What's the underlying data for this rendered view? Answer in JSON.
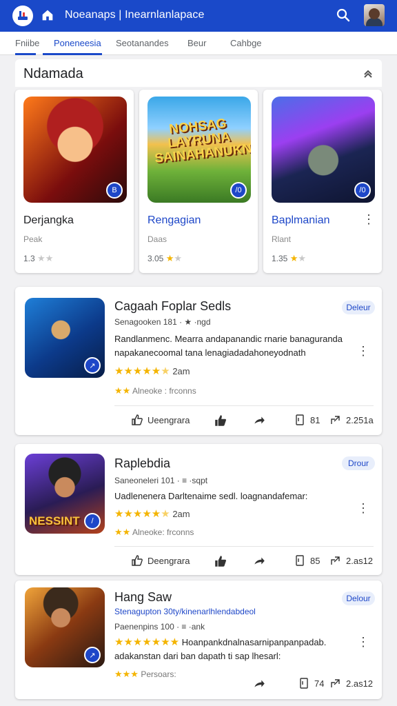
{
  "header": {
    "title": "Noeanaps | Inearnlanlapace",
    "logo_icon": "gamepad-logo-icon",
    "home_icon": "home-icon",
    "search_icon": "search-icon"
  },
  "tabs": [
    {
      "label": "Fniibe"
    },
    {
      "label": "Poneneesia"
    },
    {
      "label": "Seotanandes"
    },
    {
      "label": "Beur"
    },
    {
      "label": "Cahbge"
    }
  ],
  "section": {
    "title": "Ndamada"
  },
  "featured": [
    {
      "name": "Derjangka",
      "sub": "Peak",
      "rating": "1.3",
      "stars_on": 0,
      "stars_total": 2,
      "badge": "B"
    },
    {
      "name": "Rengagian",
      "sub": "Daas",
      "rating": "3.05",
      "stars_on": 1,
      "stars_total": 2,
      "badge": "/0"
    },
    {
      "name": "Baplmanian",
      "sub": "Rlant",
      "rating": "1.35",
      "stars_on": 1,
      "stars_total": 2,
      "badge": "/0"
    }
  ],
  "thumb_text": {
    "featured_banner": "NOHSAG LAYRUNA SAINAHANUKN",
    "list_banner": "NESSINT"
  },
  "list": [
    {
      "title": "Cagaah Foplar Sedls",
      "pill": "Deleur",
      "meta": "Senagooken 181 · ★ ·ngd",
      "desc": "Randlanmenc. Mearra andapanandic rnarie banaguranda napakanecoomal tana lenagiadadahoneyodnath",
      "stars_on": 5,
      "stars_partial": 1,
      "reviews": "2am",
      "meta2_label": "Alneoke : frconns",
      "meta2_stars": 2,
      "actions": {
        "like_label": "Ueengrara",
        "comments": "81",
        "shares": "2.251a"
      }
    },
    {
      "title": "Raplebdia",
      "pill": "Drour",
      "meta": "Saneoneleri 101 · ≡ ·sqpt",
      "desc": "Uadlenenera Darltenaime sedl. loagnandafemar:",
      "stars_on": 5,
      "stars_partial": 1,
      "reviews": "2am",
      "meta2_label": "Alneoke: frconns",
      "meta2_stars": 2,
      "actions": {
        "like_label": "Deengrara",
        "comments": "85",
        "shares": "2.as12"
      }
    },
    {
      "title": "Hang Saw",
      "pill": "Delour",
      "link": "Stenagupton 30ty/kinenarlhlendabdeol",
      "meta": "Paenenpins 100 · ≡ ·ank",
      "desc": "Hoanpankdnalnasarnipanpanpadab. adakanstan dari ban dapath ti sap lhesarl:",
      "stars_on": 7,
      "stars_partial": 0,
      "reviews": "",
      "meta2_label": "Persoars:",
      "meta2_stars": 3,
      "actions": {
        "like_label": "",
        "comments": "74",
        "shares": "2.as12"
      }
    }
  ],
  "colors": {
    "brand": "#1a49c9",
    "star": "#f4b400"
  }
}
